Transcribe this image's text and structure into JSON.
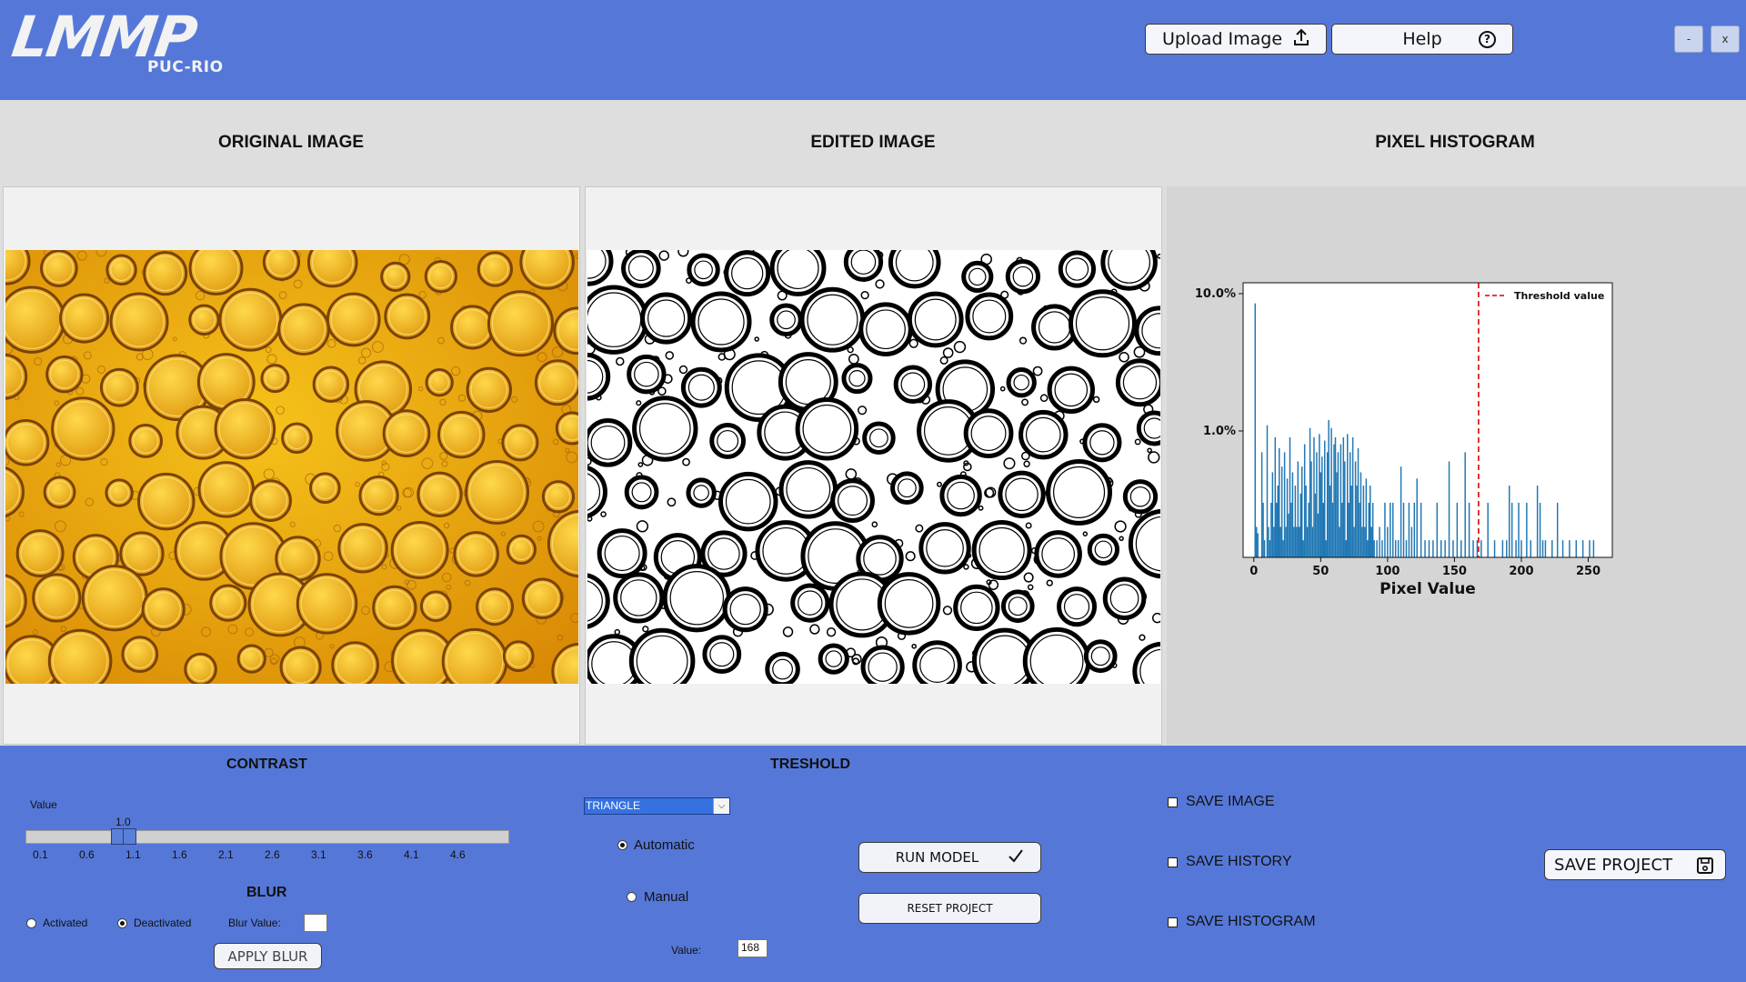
{
  "logo": {
    "main": "LMMP",
    "sub": "PUC-RIO"
  },
  "header": {
    "upload_label": "Upload Image",
    "help_label": "Help",
    "minimize_label": "-",
    "close_label": "x"
  },
  "columns": {
    "original_title": "ORIGINAL IMAGE",
    "edited_title": "EDITED IMAGE",
    "histogram_title": "PIXEL HISTOGRAM"
  },
  "chart_data": {
    "type": "bar",
    "xlabel": "Pixel Value",
    "ylabel": "",
    "yscale": "log",
    "xlim": [
      -8,
      268
    ],
    "ylim": [
      0.12,
      12
    ],
    "x_ticks": [
      0,
      50,
      100,
      150,
      200,
      250
    ],
    "y_ticks": [
      {
        "value": 1,
        "label": "1.0%"
      },
      {
        "value": 10,
        "label": "10.0%"
      }
    ],
    "threshold": {
      "value": 168,
      "label": "Threshold value",
      "color": "#e02020"
    },
    "bar_color": "#1f77b4",
    "legend_position": "top-right",
    "x": [
      1,
      2,
      3,
      6,
      7,
      8,
      10,
      11,
      12,
      13,
      14,
      15,
      16,
      17,
      18,
      19,
      20,
      21,
      22,
      23,
      24,
      25,
      26,
      27,
      28,
      29,
      30,
      31,
      32,
      33,
      34,
      35,
      36,
      37,
      38,
      39,
      40,
      41,
      42,
      43,
      44,
      45,
      46,
      47,
      48,
      49,
      50,
      51,
      52,
      53,
      54,
      55,
      56,
      57,
      58,
      59,
      60,
      61,
      62,
      63,
      64,
      65,
      66,
      67,
      68,
      69,
      70,
      71,
      72,
      73,
      74,
      75,
      76,
      77,
      78,
      79,
      80,
      81,
      82,
      83,
      84,
      85,
      86,
      87,
      88,
      89,
      90,
      92,
      94,
      96,
      98,
      100,
      102,
      104,
      106,
      108,
      110,
      112,
      114,
      116,
      118,
      120,
      122,
      125,
      128,
      131,
      134,
      137,
      140,
      143,
      146,
      149,
      152,
      155,
      158,
      161,
      164,
      167,
      170,
      175,
      180,
      186,
      189,
      191,
      193,
      196,
      198,
      200,
      204,
      207,
      212,
      214,
      216,
      218,
      223,
      227,
      231,
      236,
      241,
      246,
      251,
      254
    ],
    "values": [
      8.5,
      0.2,
      0.18,
      0.7,
      0.3,
      0.16,
      1.1,
      0.2,
      0.16,
      0.3,
      0.5,
      0.2,
      0.9,
      0.3,
      0.4,
      0.75,
      0.2,
      0.55,
      0.16,
      0.7,
      0.2,
      0.45,
      0.25,
      0.9,
      0.3,
      0.5,
      0.2,
      0.4,
      0.2,
      0.6,
      0.2,
      0.35,
      0.55,
      0.16,
      0.8,
      0.4,
      0.2,
      0.3,
      1.05,
      0.6,
      0.2,
      0.9,
      0.35,
      0.7,
      0.25,
      0.95,
      0.5,
      0.65,
      0.3,
      0.85,
      0.16,
      0.7,
      1.2,
      0.4,
      1.05,
      0.3,
      0.8,
      0.9,
      0.5,
      0.7,
      0.2,
      0.8,
      0.3,
      0.9,
      0.6,
      0.16,
      0.95,
      0.3,
      0.7,
      0.4,
      0.9,
      0.2,
      0.6,
      0.4,
      0.75,
      0.3,
      0.5,
      0.2,
      0.4,
      0.2,
      0.45,
      0.16,
      0.3,
      0.4,
      0.2,
      0.3,
      0.16,
      0.16,
      0.2,
      0.16,
      0.3,
      0.2,
      0.3,
      0.3,
      0.16,
      0.16,
      0.55,
      0.3,
      0.16,
      0.3,
      0.2,
      0.3,
      0.45,
      0.3,
      0.16,
      0.16,
      0.16,
      0.3,
      0.16,
      0.16,
      0.6,
      0.16,
      0.3,
      0.16,
      0.7,
      0.3,
      0.16,
      0.16,
      0.16,
      0.3,
      0.16,
      0.16,
      0.16,
      0.4,
      0.3,
      0.16,
      0.3,
      0.16,
      0.3,
      0.16,
      0.4,
      0.3,
      0.16,
      0.16,
      0.16,
      0.3,
      0.16,
      0.16,
      0.16,
      0.16,
      0.16,
      0.16
    ],
    "colors": {
      "background": "#ffffff",
      "axis": "#111111"
    }
  },
  "contrast": {
    "title": "CONTRAST",
    "value_label": "Value",
    "value": "1.0",
    "ticks": [
      "0.1",
      "0.6",
      "1.1",
      "1.6",
      "2.1",
      "2.6",
      "3.1",
      "3.6",
      "4.1",
      "4.6"
    ]
  },
  "blur": {
    "title": "BLUR",
    "activated_label": "Activated",
    "deactivated_label": "Deactivated",
    "selected": "Deactivated",
    "value_label": "Blur Value:",
    "value": "",
    "apply_label": "APPLY BLUR"
  },
  "threshold": {
    "title": "TRESHOLD",
    "method": "TRIANGLE",
    "automatic_label": "Automatic",
    "manual_label": "Manual",
    "selected_mode": "Automatic",
    "value_label": "Value:",
    "value": "168"
  },
  "actions": {
    "run_model_label": "RUN MODEL",
    "reset_project_label": "RESET PROJECT",
    "save_project_label": "SAVE PROJECT"
  },
  "save_options": {
    "save_image_label": "SAVE IMAGE",
    "save_history_label": "SAVE HISTORY",
    "save_histogram_label": "SAVE HISTOGRAM"
  },
  "theme": {
    "accent": "#5578d8",
    "panel": "#dedede"
  }
}
